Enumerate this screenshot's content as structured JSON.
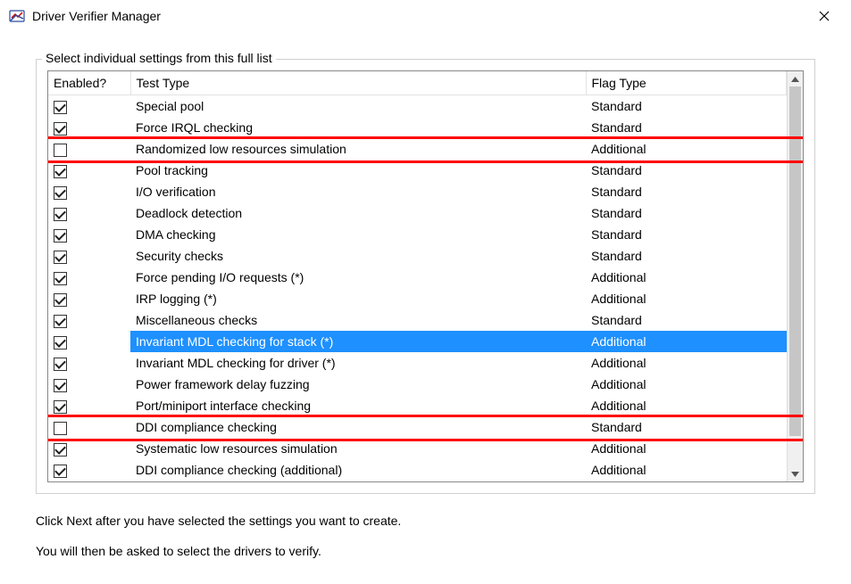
{
  "window": {
    "title": "Driver Verifier Manager"
  },
  "group": {
    "legend": "Select individual settings from this full list"
  },
  "columns": {
    "enabled": "Enabled?",
    "test": "Test Type",
    "flag": "Flag Type"
  },
  "rows": [
    {
      "enabled": true,
      "test": "Special pool",
      "flag": "Standard",
      "selected": false,
      "highlight": false
    },
    {
      "enabled": true,
      "test": "Force IRQL checking",
      "flag": "Standard",
      "selected": false,
      "highlight": false
    },
    {
      "enabled": false,
      "test": "Randomized low resources simulation",
      "flag": "Additional",
      "selected": false,
      "highlight": true
    },
    {
      "enabled": true,
      "test": "Pool tracking",
      "flag": "Standard",
      "selected": false,
      "highlight": false
    },
    {
      "enabled": true,
      "test": "I/O verification",
      "flag": "Standard",
      "selected": false,
      "highlight": false
    },
    {
      "enabled": true,
      "test": "Deadlock detection",
      "flag": "Standard",
      "selected": false,
      "highlight": false
    },
    {
      "enabled": true,
      "test": "DMA checking",
      "flag": "Standard",
      "selected": false,
      "highlight": false
    },
    {
      "enabled": true,
      "test": "Security checks",
      "flag": "Standard",
      "selected": false,
      "highlight": false
    },
    {
      "enabled": true,
      "test": "Force pending I/O requests (*)",
      "flag": "Additional",
      "selected": false,
      "highlight": false
    },
    {
      "enabled": true,
      "test": "IRP logging (*)",
      "flag": "Additional",
      "selected": false,
      "highlight": false
    },
    {
      "enabled": true,
      "test": "Miscellaneous checks",
      "flag": "Standard",
      "selected": false,
      "highlight": false
    },
    {
      "enabled": true,
      "test": "Invariant MDL checking for stack (*)",
      "flag": "Additional",
      "selected": true,
      "highlight": false
    },
    {
      "enabled": true,
      "test": "Invariant MDL checking for driver (*)",
      "flag": "Additional",
      "selected": false,
      "highlight": false
    },
    {
      "enabled": true,
      "test": "Power framework delay fuzzing",
      "flag": "Additional",
      "selected": false,
      "highlight": false
    },
    {
      "enabled": true,
      "test": "Port/miniport interface checking",
      "flag": "Additional",
      "selected": false,
      "highlight": false
    },
    {
      "enabled": false,
      "test": "DDI compliance checking",
      "flag": "Standard",
      "selected": false,
      "highlight": true
    },
    {
      "enabled": true,
      "test": "Systematic low resources simulation",
      "flag": "Additional",
      "selected": false,
      "highlight": false
    },
    {
      "enabled": true,
      "test": "DDI compliance checking (additional)",
      "flag": "Additional",
      "selected": false,
      "highlight": false
    }
  ],
  "instructions": {
    "line1": "Click Next after you have selected the settings you want to create.",
    "line2": "You will then be asked to select the drivers to verify."
  }
}
